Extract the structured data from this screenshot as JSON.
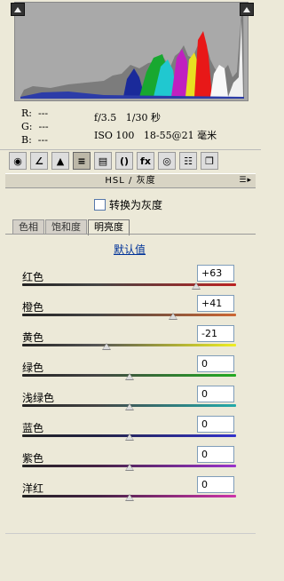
{
  "histogram": {
    "shadow_clip_icon": "triangle-up-icon",
    "highlight_clip_icon": "triangle-up-icon"
  },
  "readout": {
    "r": "R:  ---",
    "g": "G:  ---",
    "b": "B:  ---",
    "aperture_shutter": "f/3.5   1/30 秒",
    "iso_lens": "ISO 100   18-55@21 毫米"
  },
  "toolbar": {
    "buttons": [
      {
        "icon": "aperture-icon",
        "glyph": "◉"
      },
      {
        "icon": "tone-curve-icon",
        "glyph": "∠"
      },
      {
        "icon": "mountain-detail-icon",
        "glyph": "▲"
      },
      {
        "icon": "hsl-icon",
        "glyph": "≡"
      },
      {
        "icon": "split-toning-icon",
        "glyph": "▤"
      },
      {
        "icon": "lens-corrections-icon",
        "glyph": "()"
      },
      {
        "icon": "fx-icon",
        "glyph": "fx"
      },
      {
        "icon": "camera-calibration-icon",
        "glyph": "◎"
      },
      {
        "icon": "presets-icon",
        "glyph": "☷"
      },
      {
        "icon": "snapshots-icon",
        "glyph": "❐"
      }
    ]
  },
  "panel": {
    "title": "HSL / 灰度",
    "menu_icon": "☰▸",
    "convert_gray_label": "转换为灰度",
    "tabs": [
      "色相",
      "饱和度",
      "明亮度"
    ],
    "active_tab": 2,
    "default_link": "默认值",
    "sliders": [
      {
        "label": "红色",
        "value": "+63",
        "level": 63,
        "color": "#b22222"
      },
      {
        "label": "橙色",
        "value": "+41",
        "level": 41,
        "color": "#cc6633"
      },
      {
        "label": "黄色",
        "value": "-21",
        "level": -21,
        "color": "#eeee22"
      },
      {
        "label": "绿色",
        "value": "0",
        "level": 0,
        "color": "#22aa22"
      },
      {
        "label": "浅绿色",
        "value": "0",
        "level": 0,
        "color": "#22aaaa"
      },
      {
        "label": "蓝色",
        "value": "0",
        "level": 0,
        "color": "#3333cc"
      },
      {
        "label": "紫色",
        "value": "0",
        "level": 0,
        "color": "#9933cc"
      },
      {
        "label": "洋红",
        "value": "0",
        "level": 0,
        "color": "#cc33aa"
      }
    ]
  }
}
